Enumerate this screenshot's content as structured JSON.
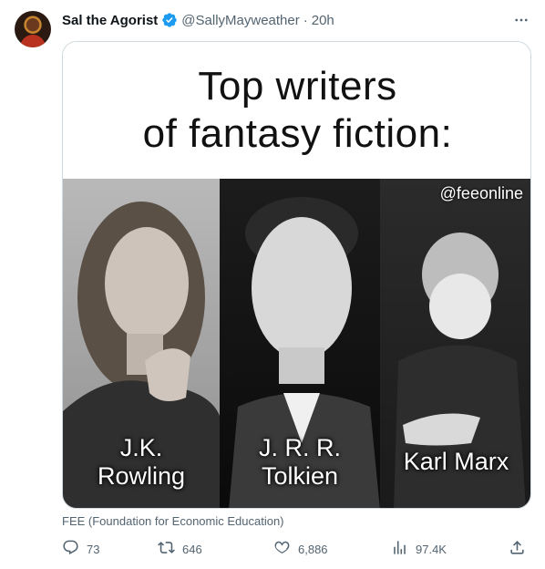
{
  "author": {
    "name": "Sal the Agorist",
    "handle": "@SallyMayweather",
    "separator": "·",
    "time": "20h",
    "verified_color": "#1d9bf0"
  },
  "media": {
    "title_line1": "Top writers",
    "title_line2": "of fantasy fiction:",
    "watermark": "@feeonline",
    "panels": [
      {
        "caption_line1": "J.K.",
        "caption_line2": "Rowling"
      },
      {
        "caption_line1": "J. R. R.",
        "caption_line2": "Tolkien"
      },
      {
        "caption_line1": "Karl Marx",
        "caption_line2": ""
      }
    ]
  },
  "source": "FEE (Foundation for Economic Education)",
  "actions": {
    "reply": {
      "icon": "reply-icon",
      "count": "73"
    },
    "retweet": {
      "icon": "retweet-icon",
      "count": "646"
    },
    "like": {
      "icon": "heart-icon",
      "count": "6,886"
    },
    "views": {
      "icon": "views-icon",
      "count": "97.4K"
    },
    "share": {
      "icon": "share-icon"
    }
  },
  "colors": {
    "text_primary": "#0f1419",
    "text_secondary": "#536471",
    "border": "#cfd9de",
    "accent": "#1d9bf0"
  }
}
